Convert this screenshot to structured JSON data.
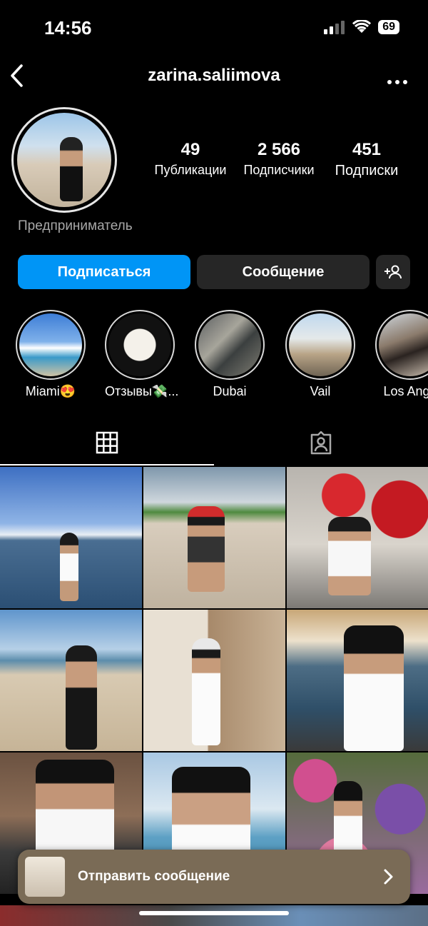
{
  "status_bar": {
    "time": "14:56",
    "battery": "69"
  },
  "header": {
    "username": "zarina.saliimova"
  },
  "profile": {
    "stats": [
      {
        "value": "49",
        "label": "Публикации"
      },
      {
        "value": "2 566",
        "label": "Подписчики"
      },
      {
        "value": "451",
        "label": "Подписки"
      }
    ],
    "bio": "Предприниматель"
  },
  "actions": {
    "follow": "Подписаться",
    "message": "Сообщение"
  },
  "highlights": [
    {
      "label": "Miami😍"
    },
    {
      "label": "Отзывы💸..."
    },
    {
      "label": "Dubai"
    },
    {
      "label": "Vail"
    },
    {
      "label": "Los Ange"
    }
  ],
  "message_bar": {
    "label": "Отправить сообщение"
  },
  "colors": {
    "accent": "#0095f6",
    "secondary_button": "#262626",
    "message_bar": "#7a6b56"
  }
}
